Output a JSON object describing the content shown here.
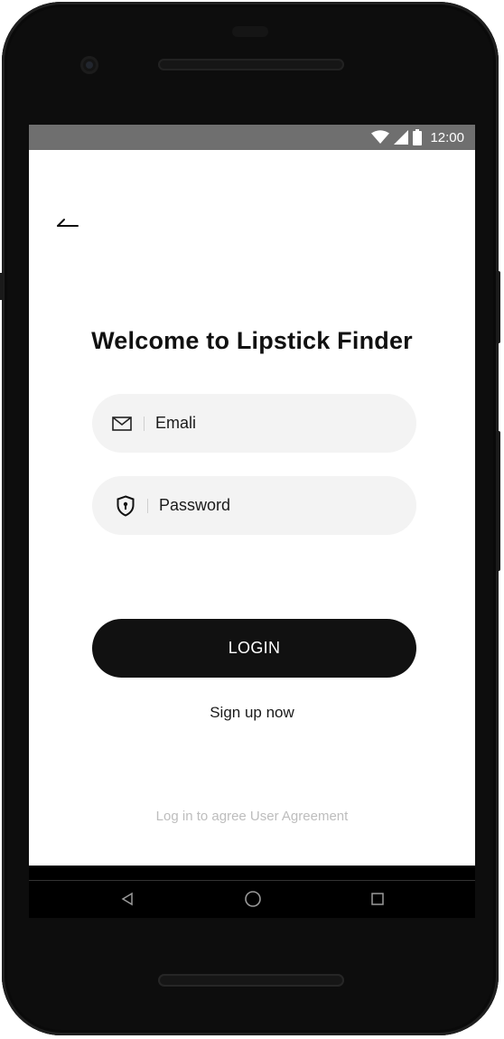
{
  "status_bar": {
    "time": "12:00",
    "icons": [
      "wifi-icon",
      "cellular-signal-icon",
      "battery-icon"
    ]
  },
  "header": {
    "back_icon": "back-arrow-icon"
  },
  "login": {
    "title": "Welcome to Lipstick Finder",
    "email": {
      "placeholder": "Emali",
      "icon": "mail-icon"
    },
    "password": {
      "placeholder": "Password",
      "icon": "shield-lock-icon"
    },
    "login_label": "LOGIN",
    "signup_label": "Sign up now",
    "agreement_text": "Log in to agree User Agreement"
  },
  "nav_bar": {
    "buttons": [
      "back-triangle-icon",
      "home-circle-icon",
      "recents-square-icon"
    ]
  },
  "colors": {
    "primary": "#111111",
    "field_background": "#f3f3f3",
    "muted_text": "#bdbdbd",
    "status_bar": "#6f6f6f"
  }
}
